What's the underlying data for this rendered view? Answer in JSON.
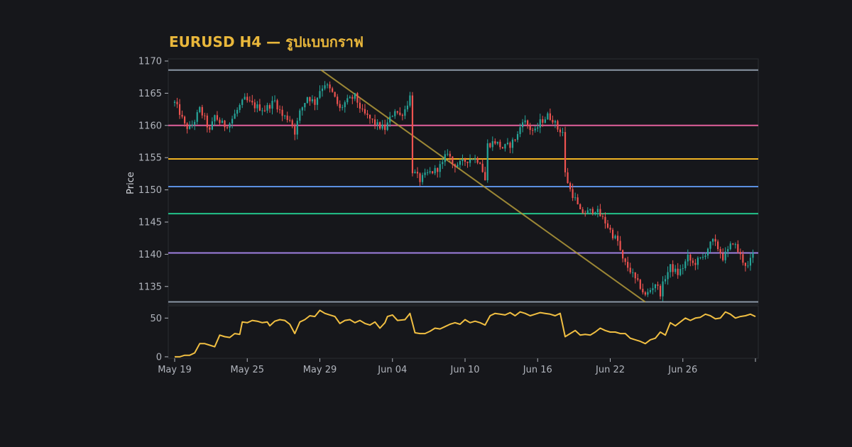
{
  "chart_data": {
    "type": "candlestick",
    "title": "EURUSD H4 — รูปแบบกราฟ",
    "ylabel": "Price",
    "price_panel": {
      "ylim": [
        1132,
        1170
      ],
      "yticks": [
        1135,
        1140,
        1145,
        1150,
        1155,
        1160,
        1165,
        1170
      ]
    },
    "indicator_panel": {
      "ylim": [
        -1,
        64
      ],
      "yticks": [
        0,
        50
      ],
      "color": "#f1bf42"
    },
    "x_range": [
      0,
      232
    ],
    "xticks": [
      {
        "label": "May 19",
        "x": 0
      },
      {
        "label": "May 25",
        "x": 29
      },
      {
        "label": "May 29",
        "x": 58
      },
      {
        "label": "Jun 04",
        "x": 87
      },
      {
        "label": "Jun 10",
        "x": 116
      },
      {
        "label": "Jun 16",
        "x": 145
      },
      {
        "label": "Jun 22",
        "x": 174
      },
      {
        "label": "Jun 26",
        "x": 203
      },
      {
        "label": "",
        "x": 232
      }
    ],
    "horizontal_levels": [
      {
        "price": 1168.6,
        "color": "#8b97a6"
      },
      {
        "price": 1160.0,
        "color": "#e2609c"
      },
      {
        "price": 1154.8,
        "color": "#f0b323"
      },
      {
        "price": 1150.5,
        "color": "#5b8fe0"
      },
      {
        "price": 1146.3,
        "color": "#22c38a"
      },
      {
        "price": 1140.2,
        "color": "#9f7fe0"
      },
      {
        "price": 1132.6,
        "color": "#8b97a6"
      }
    ],
    "trendline": {
      "x0": 58.5,
      "y0": 1168.6,
      "x1": 188,
      "y1": 1132.6,
      "color": "#b49b3a"
    },
    "colors": {
      "up": "#26a69a",
      "down": "#ef5350",
      "background": "#16171b",
      "grid": "#2a2c32",
      "text": "#b0b4bc",
      "title": "#e9b73b"
    },
    "price_anchors": [
      [
        0,
        1163.5
      ],
      [
        2,
        1162.0
      ],
      [
        4,
        1160.0
      ],
      [
        6,
        1159.5
      ],
      [
        8,
        1160.8
      ],
      [
        10,
        1162.5
      ],
      [
        12,
        1161.0
      ],
      [
        14,
        1159.0
      ],
      [
        16,
        1161.5
      ],
      [
        18,
        1160.5
      ],
      [
        20,
        1160.0
      ],
      [
        22,
        1160.4
      ],
      [
        26,
        1163.0
      ],
      [
        28,
        1164.0
      ],
      [
        32,
        1163.0
      ],
      [
        36,
        1162.5
      ],
      [
        40,
        1163.8
      ],
      [
        43,
        1161.5
      ],
      [
        46,
        1161.0
      ],
      [
        48,
        1159.0
      ],
      [
        50,
        1162.0
      ],
      [
        53,
        1164.5
      ],
      [
        56,
        1163.5
      ],
      [
        58,
        1165.5
      ],
      [
        60,
        1166.5
      ],
      [
        63,
        1165.0
      ],
      [
        66,
        1162.5
      ],
      [
        68,
        1163.5
      ],
      [
        72,
        1164.5
      ],
      [
        75,
        1162.0
      ],
      [
        78,
        1161.0
      ],
      [
        81,
        1160.0
      ],
      [
        84,
        1159.5
      ],
      [
        86,
        1161.0
      ],
      [
        88,
        1162.5
      ],
      [
        90,
        1161.5
      ],
      [
        92,
        1162.5
      ],
      [
        94,
        1164.5
      ],
      [
        95,
        1153.0
      ],
      [
        98,
        1151.5
      ],
      [
        101,
        1152.5
      ],
      [
        104,
        1153.0
      ],
      [
        107,
        1154.0
      ],
      [
        109,
        1156.0
      ],
      [
        111,
        1154.0
      ],
      [
        114,
        1154.0
      ],
      [
        116,
        1154.5
      ],
      [
        119,
        1155.0
      ],
      [
        122,
        1154.5
      ],
      [
        124,
        1151.5
      ],
      [
        125,
        1157.0
      ],
      [
        128,
        1157.5
      ],
      [
        131,
        1156.5
      ],
      [
        134,
        1157.0
      ],
      [
        137,
        1158.5
      ],
      [
        139,
        1161.0
      ],
      [
        142,
        1159.5
      ],
      [
        144,
        1159.0
      ],
      [
        146,
        1160.5
      ],
      [
        149,
        1161.5
      ],
      [
        151,
        1161.0
      ],
      [
        153,
        1159.5
      ],
      [
        155,
        1159.0
      ],
      [
        156,
        1152.5
      ],
      [
        158,
        1150.0
      ],
      [
        160,
        1148.5
      ],
      [
        162,
        1146.5
      ],
      [
        165,
        1146.5
      ],
      [
        168,
        1147.0
      ],
      [
        170,
        1146.0
      ],
      [
        172,
        1145.0
      ],
      [
        175,
        1143.0
      ],
      [
        177,
        1142.0
      ],
      [
        179,
        1139.0
      ],
      [
        182,
        1137.5
      ],
      [
        184,
        1136.0
      ],
      [
        186,
        1135.0
      ],
      [
        188,
        1133.5
      ],
      [
        190,
        1134.5
      ],
      [
        192,
        1135.5
      ],
      [
        194,
        1134.0
      ],
      [
        196,
        1136.5
      ],
      [
        198,
        1138.0
      ],
      [
        201,
        1137.0
      ],
      [
        203,
        1138.0
      ],
      [
        205,
        1139.5
      ],
      [
        207,
        1138.5
      ],
      [
        209,
        1139.0
      ],
      [
        211,
        1139.5
      ],
      [
        213,
        1141.0
      ],
      [
        215,
        1142.0
      ],
      [
        217,
        1141.0
      ],
      [
        219,
        1139.5
      ],
      [
        221,
        1140.5
      ],
      [
        223,
        1142.0
      ],
      [
        225,
        1140.5
      ],
      [
        227,
        1139.0
      ],
      [
        229,
        1138.0
      ],
      [
        231,
        1140.0
      ]
    ],
    "indicator_anchors": [
      [
        0,
        0
      ],
      [
        2,
        0
      ],
      [
        4,
        2
      ],
      [
        6,
        2
      ],
      [
        8,
        5
      ],
      [
        10,
        17
      ],
      [
        12,
        17
      ],
      [
        14,
        15
      ],
      [
        16,
        13
      ],
      [
        18,
        28
      ],
      [
        20,
        26
      ],
      [
        22,
        25
      ],
      [
        24,
        30
      ],
      [
        26,
        29
      ],
      [
        27,
        45
      ],
      [
        29,
        44
      ],
      [
        31,
        47
      ],
      [
        33,
        46
      ],
      [
        35,
        44
      ],
      [
        37,
        45
      ],
      [
        38,
        40
      ],
      [
        40,
        46
      ],
      [
        42,
        48
      ],
      [
        44,
        47
      ],
      [
        46,
        42
      ],
      [
        48,
        30
      ],
      [
        50,
        45
      ],
      [
        52,
        48
      ],
      [
        54,
        53
      ],
      [
        56,
        52
      ],
      [
        58,
        60
      ],
      [
        60,
        56
      ],
      [
        62,
        54
      ],
      [
        64,
        52
      ],
      [
        66,
        43
      ],
      [
        68,
        47
      ],
      [
        70,
        48
      ],
      [
        72,
        44
      ],
      [
        74,
        47
      ],
      [
        76,
        43
      ],
      [
        78,
        41
      ],
      [
        80,
        45
      ],
      [
        82,
        37
      ],
      [
        84,
        44
      ],
      [
        85,
        52
      ],
      [
        87,
        54
      ],
      [
        89,
        47
      ],
      [
        92,
        48
      ],
      [
        94,
        56
      ],
      [
        96,
        31
      ],
      [
        98,
        30
      ],
      [
        100,
        30
      ],
      [
        102,
        33
      ],
      [
        104,
        37
      ],
      [
        106,
        36
      ],
      [
        108,
        39
      ],
      [
        110,
        42
      ],
      [
        112,
        44
      ],
      [
        114,
        42
      ],
      [
        116,
        48
      ],
      [
        118,
        44
      ],
      [
        120,
        46
      ],
      [
        122,
        44
      ],
      [
        124,
        41
      ],
      [
        126,
        53
      ],
      [
        128,
        56
      ],
      [
        130,
        55
      ],
      [
        132,
        54
      ],
      [
        134,
        57
      ],
      [
        136,
        53
      ],
      [
        138,
        58
      ],
      [
        140,
        56
      ],
      [
        142,
        53
      ],
      [
        144,
        55
      ],
      [
        146,
        57
      ],
      [
        148,
        56
      ],
      [
        150,
        55
      ],
      [
        152,
        53
      ],
      [
        154,
        56
      ],
      [
        156,
        26
      ],
      [
        158,
        30
      ],
      [
        160,
        34
      ],
      [
        162,
        28
      ],
      [
        164,
        29
      ],
      [
        166,
        28
      ],
      [
        168,
        32
      ],
      [
        170,
        37
      ],
      [
        172,
        34
      ],
      [
        174,
        32
      ],
      [
        176,
        32
      ],
      [
        178,
        30
      ],
      [
        180,
        30
      ],
      [
        182,
        24
      ],
      [
        184,
        22
      ],
      [
        186,
        20
      ],
      [
        188,
        17
      ],
      [
        190,
        22
      ],
      [
        192,
        24
      ],
      [
        194,
        32
      ],
      [
        196,
        28
      ],
      [
        198,
        44
      ],
      [
        200,
        40
      ],
      [
        202,
        45
      ],
      [
        204,
        50
      ],
      [
        206,
        47
      ],
      [
        208,
        50
      ],
      [
        210,
        51
      ],
      [
        212,
        55
      ],
      [
        214,
        53
      ],
      [
        216,
        49
      ],
      [
        218,
        50
      ],
      [
        220,
        58
      ],
      [
        222,
        55
      ],
      [
        224,
        50
      ],
      [
        226,
        52
      ],
      [
        228,
        53
      ],
      [
        230,
        55
      ],
      [
        232,
        52
      ]
    ]
  }
}
